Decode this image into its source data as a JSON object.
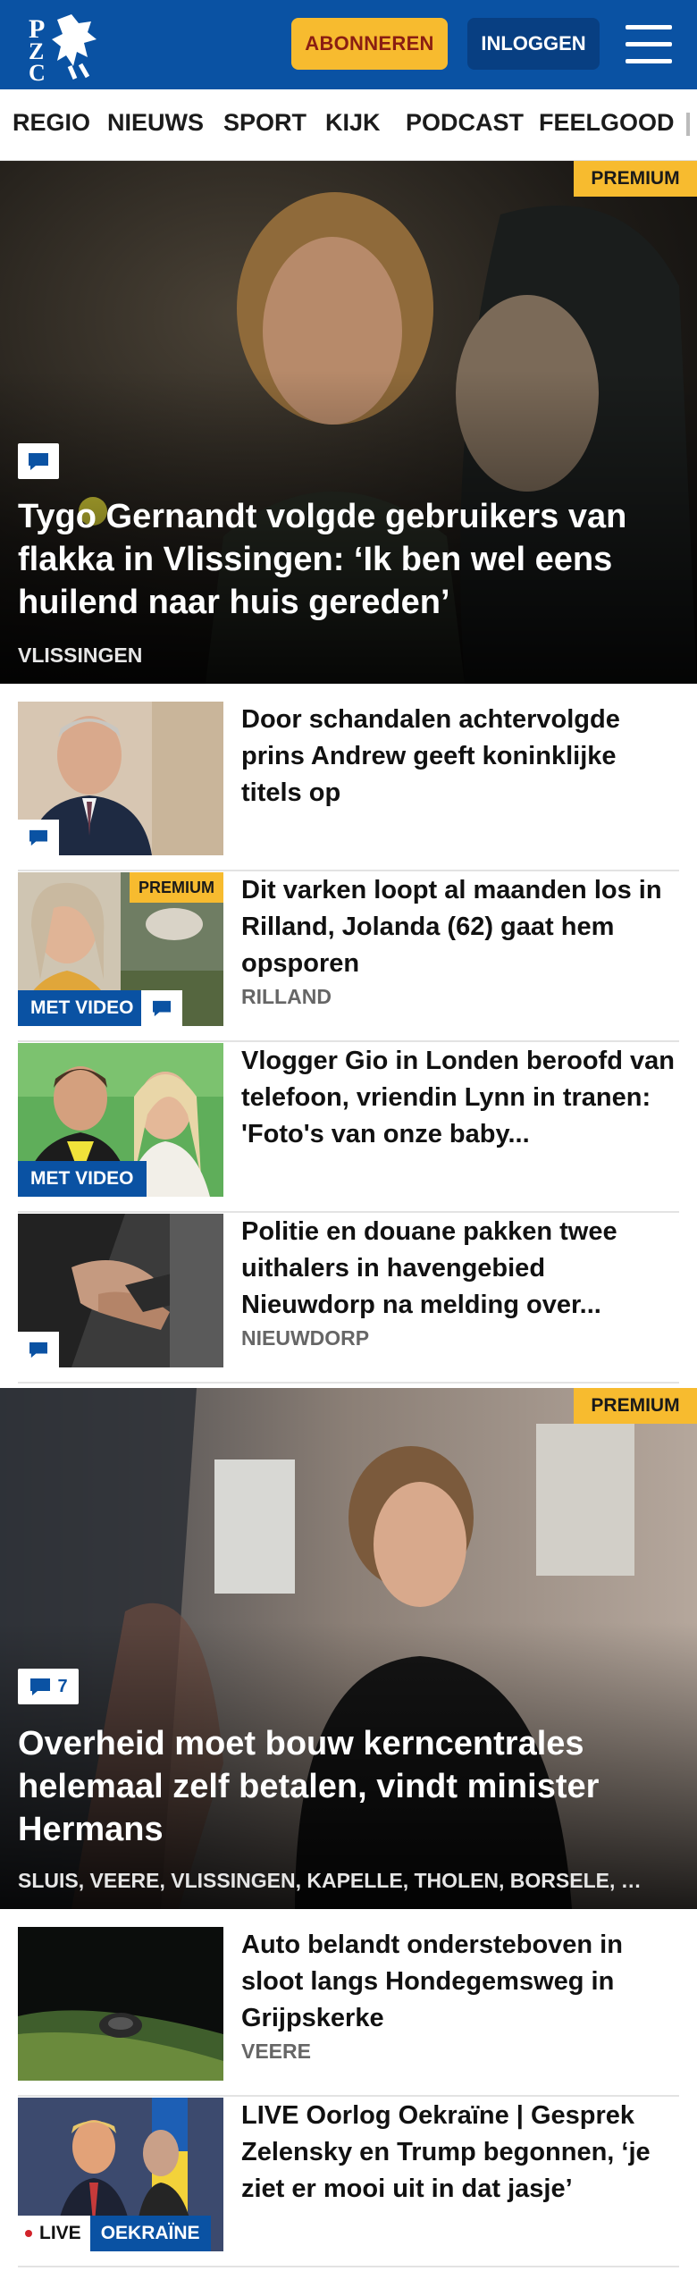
{
  "header": {
    "logo_text": "PZC",
    "subscribe_label": "ABONNEREN",
    "login_label": "INLOGGEN"
  },
  "nav": {
    "items": [
      "REGIO",
      "NIEUWS",
      "SPORT",
      "KIJK",
      "PODCAST",
      "FEELGOOD"
    ]
  },
  "hero1": {
    "premium": "PREMIUM",
    "title": "Tygo Gernandt volgde gebruikers van flakka in Vlissingen: ‘Ik ben wel eens huilend naar huis gereden’",
    "location": "VLISSINGEN"
  },
  "articles1": [
    {
      "title": "Door schandalen achtervolgde prins Andrew geeft koninklijke titels op"
    },
    {
      "title": "Dit varken loopt al maanden los in Rilland, Jolanda (62) gaat hem opsporen",
      "location": "RILLAND",
      "premium": "PREMIUM",
      "video": "MET VIDEO"
    },
    {
      "title": "Vlogger Gio in Londen beroofd van telefoon, vriendin Lynn in tranen: 'Foto's van onze baby...",
      "video": "MET VIDEO"
    },
    {
      "title": "Politie en douane pakken twee uithalers in havengebied Nieuwdorp na melding over...",
      "location": "NIEUWDORP"
    }
  ],
  "hero2": {
    "premium": "PREMIUM",
    "comment_count": "7",
    "title": "Overheid moet bouw kerncentrales helemaal zelf betalen, vindt minister Hermans",
    "location": "SLUIS, VEERE, VLISSINGEN, KAPELLE, THOLEN, BORSELE, …"
  },
  "articles2": [
    {
      "title": "Auto belandt ondersteboven in sloot langs Hondegemsweg in Grijpskerke",
      "location": "VEERE"
    },
    {
      "title": "LIVE Oorlog Oekraïne | Gesprek Zelensky en Trump begonnen, ‘je ziet er mooi uit in dat jasje’",
      "live": "LIVE",
      "topic": "OEKRAÏNE"
    }
  ],
  "colors": {
    "brand_blue": "#0a52a3",
    "accent_yellow": "#f7bb2f"
  },
  "icons": [
    "logo-icon",
    "menu-icon",
    "comment-icon"
  ]
}
